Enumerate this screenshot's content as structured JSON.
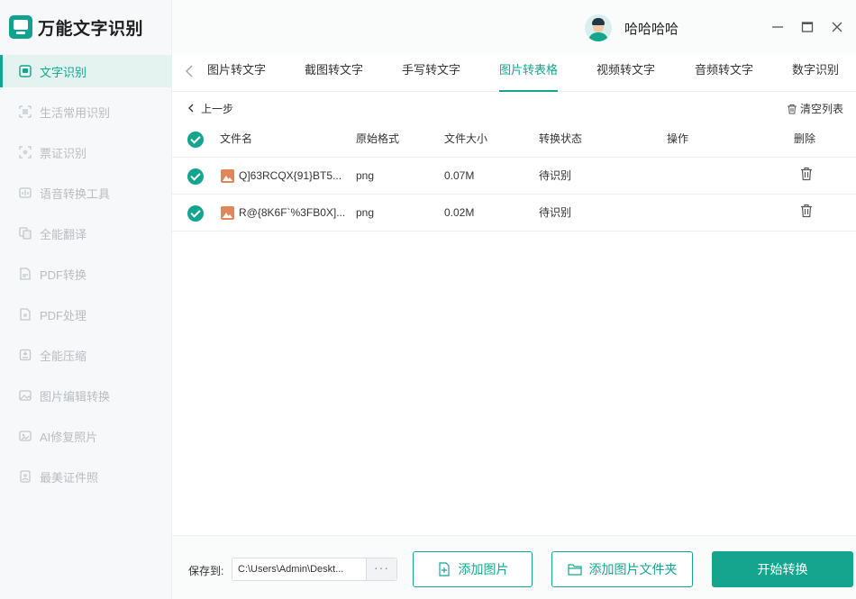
{
  "app": {
    "title": "万能文字识别"
  },
  "colors": {
    "accent": "#15a58f",
    "sidebar_bg": "#f7f8f9",
    "file_icon": "#e0865a"
  },
  "user": {
    "name": "哈哈哈哈"
  },
  "sidebar": {
    "items": [
      {
        "label": "文字识别",
        "icon": "ocr-icon",
        "active": true
      },
      {
        "label": "生活常用识别",
        "icon": "scan-icon"
      },
      {
        "label": "票证识别",
        "icon": "ticket-icon"
      },
      {
        "label": "语音转换工具",
        "icon": "audio-icon"
      },
      {
        "label": "全能翻译",
        "icon": "translate-icon"
      },
      {
        "label": "PDF转换",
        "icon": "pdf-icon"
      },
      {
        "label": "PDF处理",
        "icon": "pdf-process-icon"
      },
      {
        "label": "全能压缩",
        "icon": "compress-icon"
      },
      {
        "label": "图片编辑转换",
        "icon": "image-edit-icon"
      },
      {
        "label": "AI修复照片",
        "icon": "ai-photo-icon"
      },
      {
        "label": "最美证件照",
        "icon": "id-photo-icon"
      }
    ]
  },
  "tabs": [
    {
      "label": "图片转文字"
    },
    {
      "label": "截图转文字"
    },
    {
      "label": "手写转文字"
    },
    {
      "label": "图片转表格",
      "active": true
    },
    {
      "label": "视频转文字"
    },
    {
      "label": "音频转文字"
    },
    {
      "label": "数字识别"
    }
  ],
  "toolbar": {
    "back_label": "上一步",
    "clear_label": "清空列表"
  },
  "table": {
    "headers": {
      "name": "文件名",
      "format": "原始格式",
      "size": "文件大小",
      "status": "转换状态",
      "operation": "操作",
      "delete": "删除"
    },
    "rows": [
      {
        "name": "Q]63RCQX{91}BT5...",
        "format": "png",
        "size": "0.07M",
        "status": "待识别"
      },
      {
        "name": "R@{8K6F`%3FB0X]...",
        "format": "png",
        "size": "0.02M",
        "status": "待识别"
      }
    ]
  },
  "footer": {
    "save_label": "保存到:",
    "save_path": "C:\\Users\\Admin\\Deskt...",
    "more_label": "···",
    "add_image_label": "添加图片",
    "add_folder_label": "添加图片文件夹",
    "start_label": "开始转换"
  }
}
